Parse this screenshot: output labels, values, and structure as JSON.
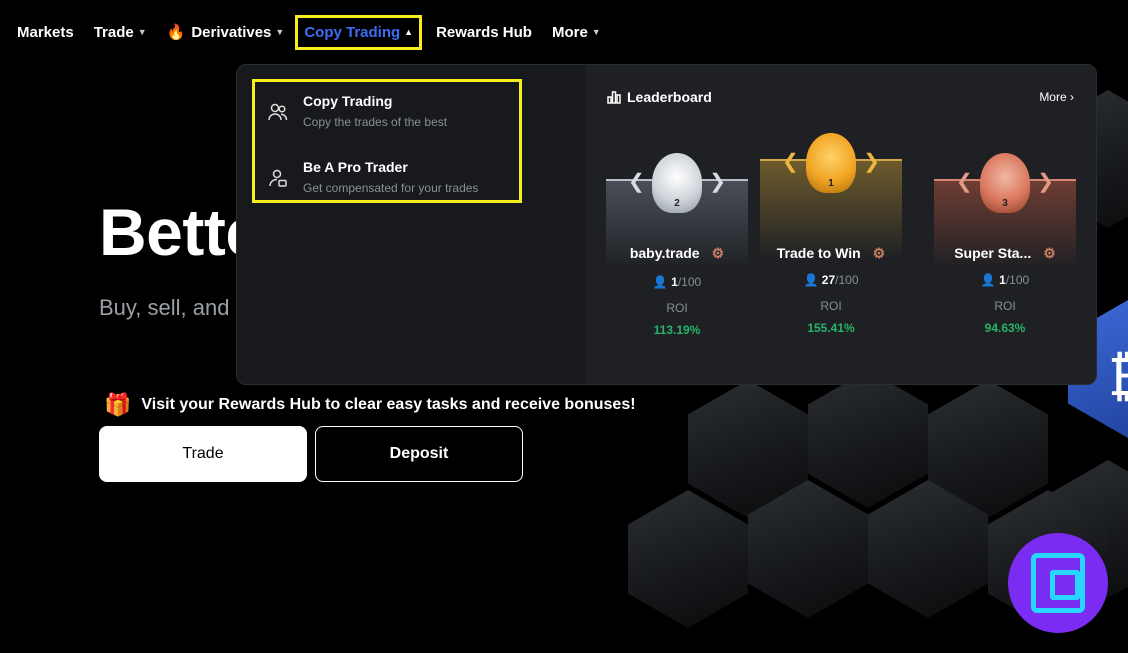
{
  "nav": {
    "items": [
      {
        "label": "Markets",
        "caret": false
      },
      {
        "label": "Trade",
        "caret": true
      },
      {
        "label": "Derivatives",
        "caret": true,
        "icon": "flame-icon"
      },
      {
        "label": "Copy Trading",
        "caret": true,
        "active": true
      },
      {
        "label": "Rewards Hub",
        "caret": false
      },
      {
        "label": "More",
        "caret": true
      }
    ]
  },
  "hero": {
    "title": "Bette",
    "subtitle": "Buy, sell, and",
    "promo": "Visit your Rewards Hub to clear easy tasks and receive bonuses!",
    "trade_button": "Trade",
    "deposit_button": "Deposit"
  },
  "dropdown": {
    "options": [
      {
        "title": "Copy Trading",
        "desc": "Copy the trades of the best",
        "icon": "users-icon"
      },
      {
        "title": "Be A Pro Trader",
        "desc": "Get compensated for your trades",
        "icon": "user-pro-icon"
      }
    ],
    "leaderboard": {
      "title": "Leaderboard",
      "more": "More",
      "traders": [
        {
          "rank": "2",
          "name": "baby.trade",
          "followers": "1",
          "capacity": "/100",
          "roi_label": "ROI",
          "roi": "113.19%"
        },
        {
          "rank": "1",
          "name": "Trade to Win",
          "followers": "27",
          "capacity": "/100",
          "roi_label": "ROI",
          "roi": "155.41%"
        },
        {
          "rank": "3",
          "name": "Super Sta...",
          "followers": "1",
          "capacity": "/100",
          "roi_label": "ROI",
          "roi": "94.63%"
        }
      ]
    }
  },
  "colors": {
    "accent": "#3f6cf2",
    "highlight": "#f5ee1c",
    "positive": "#27b36a",
    "logo_bg": "#7a2cf2"
  }
}
